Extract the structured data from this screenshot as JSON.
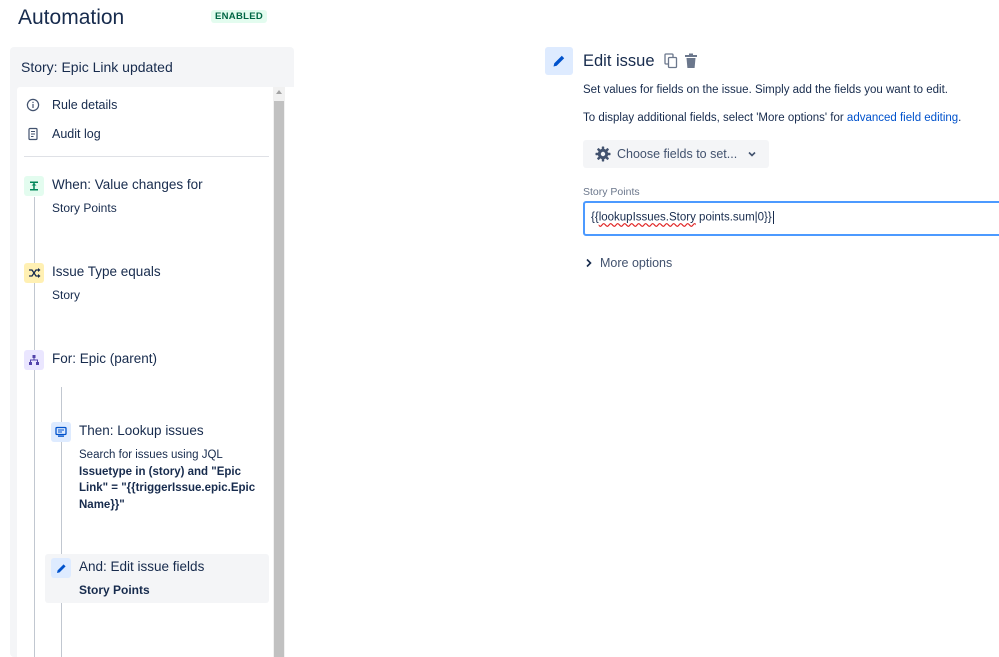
{
  "app": {
    "title": "Automation",
    "status": "ENABLED"
  },
  "rule": {
    "name": "Story: Epic Link updated",
    "links": [
      "Rule details",
      "Audit log"
    ],
    "steps": [
      {
        "title": "When: Value changes for",
        "sub": "Story Points",
        "icon": "trigger-icon",
        "color": "#e3fcef"
      },
      {
        "title": "Issue Type equals",
        "sub": "Story",
        "icon": "condition-icon",
        "color": "#fff0b3"
      },
      {
        "title": "For: Epic (parent)",
        "icon": "branch-icon",
        "color": "#eae6ff"
      },
      {
        "title": "Then: Lookup issues",
        "desc": "Search for issues using JQL",
        "jql_l1": "Issuetype in (story) and \"Epic",
        "jql_l2": "Link\" = \"{{triggerIssue.epic.Epic",
        "jql_l3": "Name}}\"",
        "icon": "lookup-icon",
        "color": "#deebff"
      },
      {
        "title": "And: Edit issue fields",
        "sub": "Story Points",
        "icon": "pencil-icon",
        "color": "#deebff"
      }
    ]
  },
  "editor": {
    "title": "Edit issue",
    "desc1": "Set values for fields on the issue. Simply add the fields you want to edit.",
    "desc2_prefix": "To display additional fields, select 'More options' for ",
    "desc2_link": "advanced field editing",
    "desc2_suffix": ".",
    "choose_label": "Choose fields to set...",
    "field_label": "Story Points",
    "field_value_a": "{{",
    "field_value_b": "lookupIssues.Story",
    "field_value_c": " points.sum|0}}",
    "more_label": "More options"
  },
  "colors": {
    "accent": "#0052cc",
    "text": "#172b4d",
    "badge_bg": "#e3fcef",
    "badge_fg": "#006644",
    "focus": "#4c9aff"
  }
}
